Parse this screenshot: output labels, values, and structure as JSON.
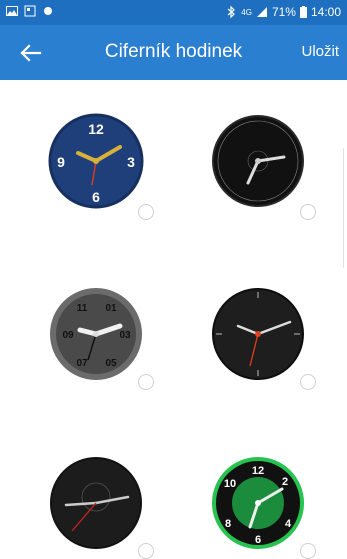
{
  "status_bar": {
    "battery": "71%",
    "time": "14:00",
    "network": "4G"
  },
  "app_bar": {
    "title": "Ciferník hodinek",
    "save_label": "Uložit"
  },
  "faces": [
    {
      "name": "navy-sport",
      "numerals": [
        "12",
        "3",
        "6",
        "9"
      ],
      "bg": "#1f3f7a",
      "selected": false
    },
    {
      "name": "black-silver",
      "bg": "#222222",
      "selected": false
    },
    {
      "name": "gray-numbered",
      "numerals": [
        "11",
        "01",
        "09",
        "03",
        "07",
        "05"
      ],
      "bg": "#555555",
      "selected": false
    },
    {
      "name": "black-minimal",
      "bg": "#1e1e1e",
      "selected": false
    },
    {
      "name": "dark-sub",
      "bg": "#1a1a1a",
      "selected": false
    },
    {
      "name": "green-bezel",
      "numerals": [
        "12",
        "2",
        "4",
        "6",
        "8",
        "10"
      ],
      "bg": "#1da34a",
      "selected": false
    }
  ],
  "colors": {
    "accent": "#2b7fd1",
    "statusbar": "#1e6fc0"
  }
}
